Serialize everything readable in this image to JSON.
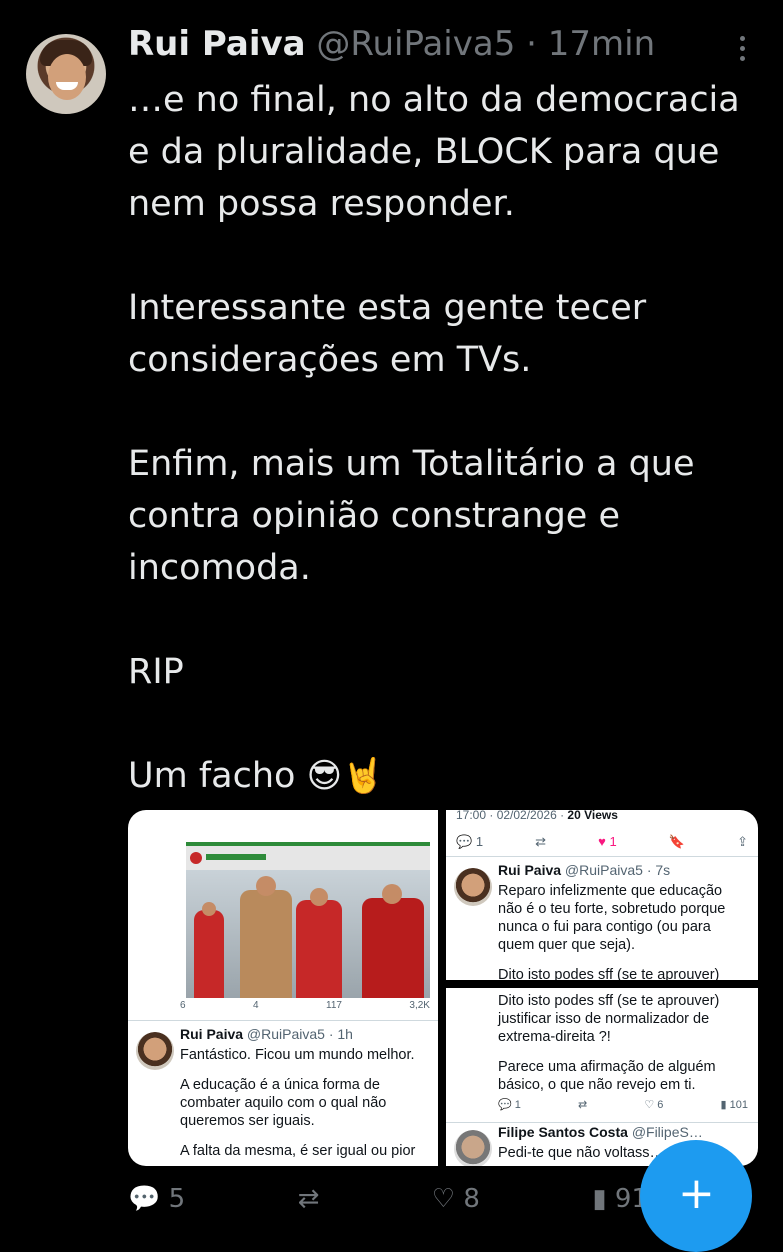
{
  "tweet": {
    "author_name": "Rui Paiva",
    "handle": "@RuiPaiva5",
    "separator": "·",
    "time": "17min",
    "paragraphs": [
      [
        "…e no final, no alto da democracia",
        "e da pluralidade, BLOCK para que",
        "nem possa responder."
      ],
      [
        "Interessante esta gente tecer",
        "considerações em TVs."
      ],
      [
        "Enfim, mais um Totalitário a que",
        "contra opinião constrange e",
        "incomoda."
      ],
      [
        "RIP"
      ],
      [
        "Um facho"
      ]
    ],
    "emoji": "😎🤘"
  },
  "media": {
    "left": {
      "stats": [
        "6",
        "4",
        "117",
        "3,2K"
      ],
      "reply": {
        "name": "Rui Paiva",
        "handle": "@RuiPaiva5 · 1h",
        "lines": [
          "Fantástico. Ficou um mundo melhor.",
          "A educação é a única forma de combater aquilo com o qual não queremos ser iguais.",
          "A falta da mesma, é ser igual ou pior"
        ]
      }
    },
    "top_right": {
      "timestamp": "17:00 · 02/02/2026 · ",
      "views": "20 Views",
      "actions": [
        "1",
        "",
        "1",
        ""
      ],
      "reply": {
        "name": "Rui Paiva",
        "handle": "@RuiPaiva5 · 7s",
        "lines": [
          "Reparo infelizmente que educação não é o teu forte, sobretudo porque nunca o fui para contigo (ou para quem quer que seja).",
          "Dito isto podes sff (se te aprouver)"
        ]
      }
    },
    "bottom_right": {
      "lines": [
        "Dito isto podes sff (se te aprouver) justificar isso de normalizador de extrema-direita ?!",
        "Parece uma afirmação de alguém básico, o que não revejo em ti."
      ],
      "stats": [
        "1",
        "",
        "6",
        "101"
      ],
      "next_name": "Filipe Santos Costa",
      "next_handle": "@FilipeS…",
      "next_text": "Pedi-te que não voltass…"
    }
  },
  "bottom_actions": [
    "5",
    "",
    "8",
    "91"
  ],
  "icons": [
    "more-icon",
    "compose-fab-icon",
    "reply-icon",
    "retweet-icon",
    "like-icon",
    "views-icon"
  ],
  "colors": {
    "background": "#000000",
    "text": "#e7e9ea",
    "muted": "#71767b",
    "accent": "#1d9bf0"
  }
}
